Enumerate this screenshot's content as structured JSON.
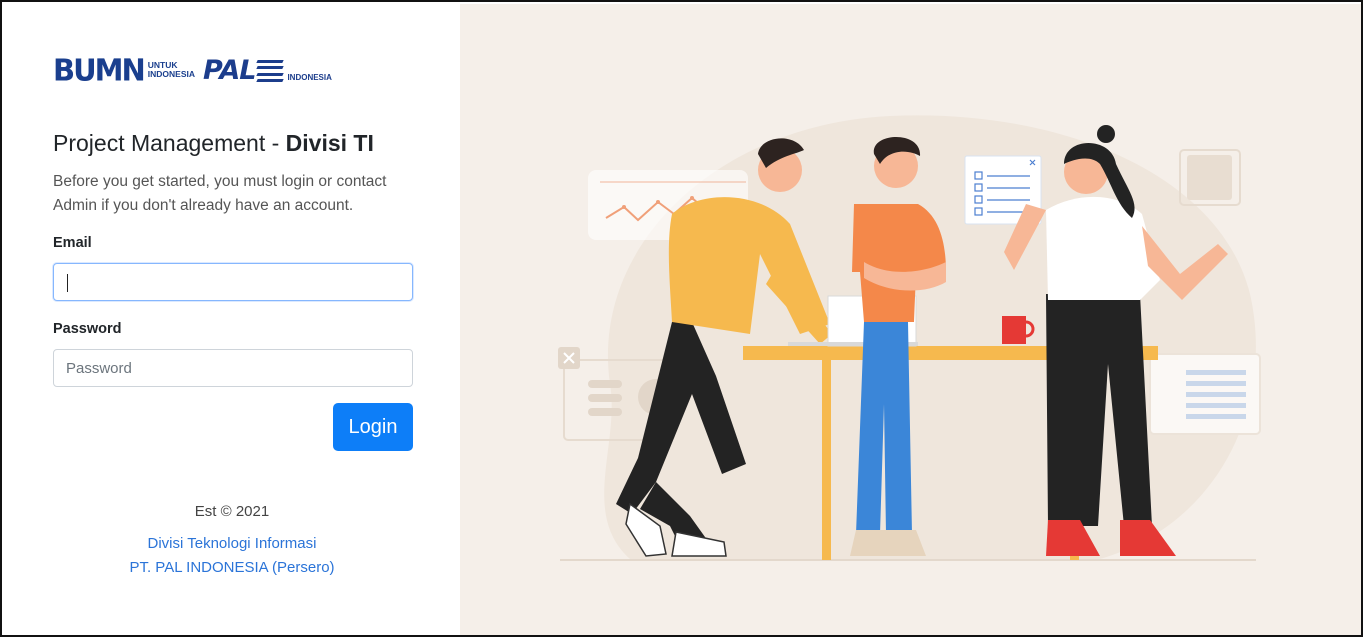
{
  "brand": {
    "bumn_text": "BUMN",
    "bumn_tagline_line1": "UNTUK",
    "bumn_tagline_line2": "INDONESIA",
    "pal_text": "PAL",
    "pal_tagline": "INDONESIA"
  },
  "header": {
    "title_prefix": "Project Management - ",
    "title_bold": "Divisi TI",
    "subtitle": "Before you get started, you must login or contact Admin if you don't already have an account."
  },
  "form": {
    "email_label": "Email",
    "email_value": "",
    "password_label": "Password",
    "password_placeholder": "Password",
    "login_label": "Login"
  },
  "footer": {
    "est": "Est © 2021",
    "division": "Divisi Teknologi Informasi",
    "company": "PT. PAL INDONESIA (Persero)"
  },
  "colors": {
    "primary": "#0d7ef8",
    "link": "#2b74d8",
    "panel_bg": "#f5efe9"
  }
}
